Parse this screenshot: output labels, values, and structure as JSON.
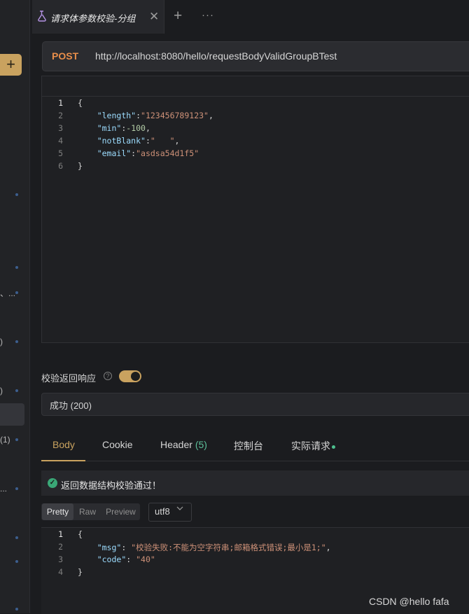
{
  "tab": {
    "title": "请求体参数校验-分组",
    "close": "✕",
    "plus": "+",
    "more": "···"
  },
  "sidebar": {
    "add": "+",
    "texts": [
      "、...",
      ")",
      ")",
      "(1)",
      "..."
    ]
  },
  "request": {
    "method": "POST",
    "url": "http://localhost:8080/hello/requestBodyValidGroupBTest"
  },
  "body_lines": [
    {
      "no": "1"
    },
    {
      "no": "2",
      "key": "\"length\"",
      "value": "\"123456789123\""
    },
    {
      "no": "3",
      "key": "\"min\"",
      "value": "-100"
    },
    {
      "no": "4",
      "key": "\"notBlank\"",
      "value": "\"   \""
    },
    {
      "no": "5",
      "key": "\"email\"",
      "value": "\"asdsa54d1f5\""
    },
    {
      "no": "6"
    }
  ],
  "validation": {
    "label": "校验返回响应",
    "help": "?",
    "enabled": true,
    "status": "成功 (200)"
  },
  "response_tabs": {
    "body": "Body",
    "cookie": "Cookie",
    "header": "Header",
    "header_count": "(5)",
    "console": "控制台",
    "actual": "实际请求"
  },
  "check_message": "返回数据结构校验通过！",
  "format": {
    "pretty": "Pretty",
    "raw": "Raw",
    "preview": "Preview",
    "encoding": "utf8"
  },
  "response_lines": [
    {
      "no": "1"
    },
    {
      "no": "2",
      "key": "\"msg\"",
      "value": "\"校验失败:不能为空字符串;邮箱格式错误;最小是1;\""
    },
    {
      "no": "3",
      "key": "\"code\"",
      "value": "\"40\""
    },
    {
      "no": "4"
    }
  ],
  "watermark": "CSDN @hello fafa",
  "colors": {
    "accent": "#c9a25f",
    "method": "#e98e4a",
    "success": "#3aa777"
  }
}
